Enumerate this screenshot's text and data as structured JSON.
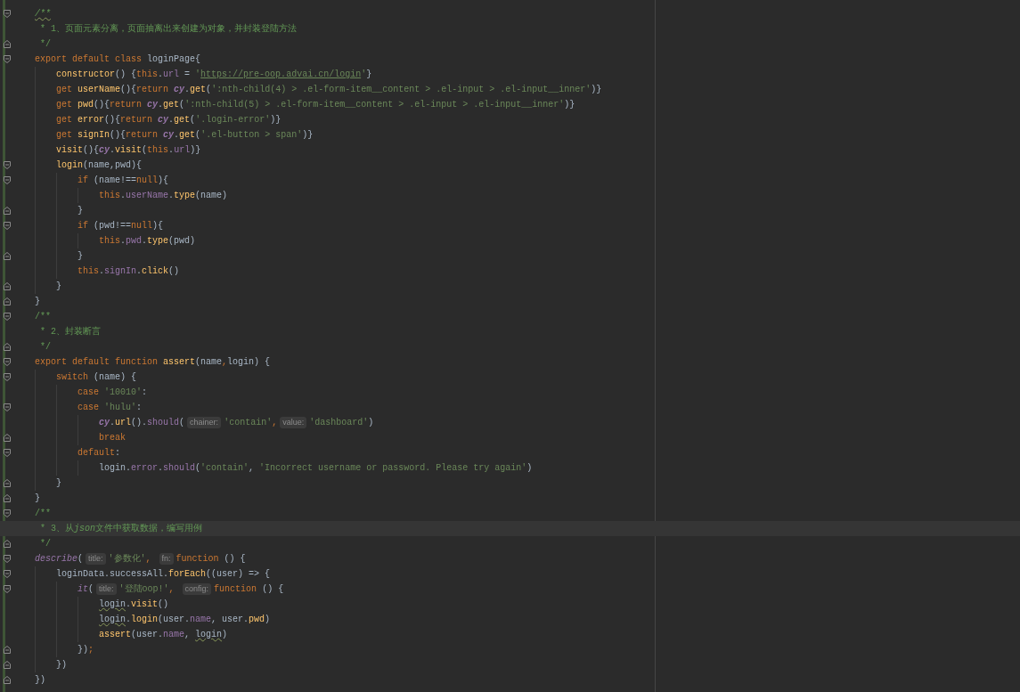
{
  "editor": {
    "lines": [
      {
        "fold_start": true,
        "fold_end": false,
        "tokens": [
          {
            "kind": "doc-squiggle",
            "text": "/**"
          }
        ]
      },
      {
        "fold_start": false,
        "fold_end": false,
        "tokens": [
          {
            "kind": "doc-body",
            "text": "* 1、页面元素分离，页面抽离出来创建为对象，并封装登陆方法"
          }
        ]
      },
      {
        "fold_start": false,
        "fold_end": true,
        "tokens": [
          {
            "kind": "doc-body",
            "text": "*/"
          }
        ]
      },
      {
        "fold_start": true,
        "fold_end": false,
        "tokens": [
          {
            "kind": "keyword",
            "text": "export default class "
          },
          {
            "kind": "plain",
            "text": "loginPage{"
          }
        ],
        "children": [
          {
            "fold_start": false,
            "fold_end": false,
            "tokens": [
              {
                "kind": "fn",
                "text": "constructor"
              },
              {
                "kind": "plain",
                "text": "() {"
              },
              {
                "kind": "keyword",
                "text": "this"
              },
              {
                "kind": "plain",
                "text": "."
              },
              {
                "kind": "field",
                "text": "url"
              },
              {
                "kind": "plain",
                "text": " = "
              },
              {
                "kind": "string",
                "text": "'"
              },
              {
                "kind": "url",
                "text": "https://pre-oop.advai.cn/login"
              },
              {
                "kind": "string",
                "text": "'"
              },
              {
                "kind": "plain",
                "text": "}"
              }
            ]
          },
          {
            "fold_start": false,
            "fold_end": false,
            "tokens": [
              {
                "kind": "keyword",
                "text": "get "
              },
              {
                "kind": "fn",
                "text": "userName"
              },
              {
                "kind": "plain",
                "text": "(){"
              },
              {
                "kind": "keyword",
                "text": "return "
              },
              {
                "kind": "cy",
                "text": "cy"
              },
              {
                "kind": "plain",
                "text": "."
              },
              {
                "kind": "fn",
                "text": "get"
              },
              {
                "kind": "plain",
                "text": "("
              },
              {
                "kind": "string",
                "text": "':nth-child(4) > .el-form-item__content > .el-input > .el-input__inner'"
              },
              {
                "kind": "plain",
                "text": ")}"
              }
            ]
          },
          {
            "fold_start": false,
            "fold_end": false,
            "tokens": [
              {
                "kind": "keyword",
                "text": "get "
              },
              {
                "kind": "fn",
                "text": "pwd"
              },
              {
                "kind": "plain",
                "text": "(){"
              },
              {
                "kind": "keyword",
                "text": "return "
              },
              {
                "kind": "cy",
                "text": "cy"
              },
              {
                "kind": "plain",
                "text": "."
              },
              {
                "kind": "fn",
                "text": "get"
              },
              {
                "kind": "plain",
                "text": "("
              },
              {
                "kind": "string",
                "text": "':nth-child(5) > .el-form-item__content > .el-input > .el-input__inner'"
              },
              {
                "kind": "plain",
                "text": ")}"
              }
            ]
          },
          {
            "fold_start": false,
            "fold_end": false,
            "tokens": [
              {
                "kind": "keyword",
                "text": "get "
              },
              {
                "kind": "fn",
                "text": "error"
              },
              {
                "kind": "plain",
                "text": "(){"
              },
              {
                "kind": "keyword",
                "text": "return "
              },
              {
                "kind": "cy",
                "text": "cy"
              },
              {
                "kind": "plain",
                "text": "."
              },
              {
                "kind": "fn",
                "text": "get"
              },
              {
                "kind": "plain",
                "text": "("
              },
              {
                "kind": "string",
                "text": "'.login-error'"
              },
              {
                "kind": "plain",
                "text": ")}"
              }
            ]
          },
          {
            "fold_start": false,
            "fold_end": false,
            "tokens": [
              {
                "kind": "keyword",
                "text": "get "
              },
              {
                "kind": "fn",
                "text": "signIn"
              },
              {
                "kind": "plain",
                "text": "(){"
              },
              {
                "kind": "keyword",
                "text": "return "
              },
              {
                "kind": "cy",
                "text": "cy"
              },
              {
                "kind": "plain",
                "text": "."
              },
              {
                "kind": "fn",
                "text": "get"
              },
              {
                "kind": "plain",
                "text": "("
              },
              {
                "kind": "string",
                "text": "'.el-button > span'"
              },
              {
                "kind": "plain",
                "text": ")}"
              }
            ]
          },
          {
            "fold_start": false,
            "fold_end": false,
            "tokens": [
              {
                "kind": "fn",
                "text": "visit"
              },
              {
                "kind": "plain",
                "text": "(){"
              },
              {
                "kind": "cy",
                "text": "cy"
              },
              {
                "kind": "plain",
                "text": "."
              },
              {
                "kind": "fn",
                "text": "visit"
              },
              {
                "kind": "plain",
                "text": "("
              },
              {
                "kind": "keyword",
                "text": "this"
              },
              {
                "kind": "plain",
                "text": "."
              },
              {
                "kind": "field",
                "text": "url"
              },
              {
                "kind": "plain",
                "text": ")}"
              }
            ]
          },
          {
            "fold_start": true,
            "fold_end": false,
            "tokens": [
              {
                "kind": "fn",
                "text": "login"
              },
              {
                "kind": "plain",
                "text": "(name,pwd){"
              }
            ],
            "children": [
              {
                "fold_start": true,
                "fold_end": false,
                "tokens": [
                  {
                    "kind": "keyword",
                    "text": "if "
                  },
                  {
                    "kind": "plain",
                    "text": "(name!=="
                  },
                  {
                    "kind": "keyword",
                    "text": "null"
                  },
                  {
                    "kind": "plain",
                    "text": "){"
                  }
                ],
                "children": [
                  {
                    "fold_start": false,
                    "fold_end": false,
                    "tokens": [
                      {
                        "kind": "keyword",
                        "text": "this"
                      },
                      {
                        "kind": "plain",
                        "text": "."
                      },
                      {
                        "kind": "field",
                        "text": "userName"
                      },
                      {
                        "kind": "plain",
                        "text": "."
                      },
                      {
                        "kind": "fn",
                        "text": "type"
                      },
                      {
                        "kind": "plain",
                        "text": "(name)"
                      }
                    ]
                  }
                ]
              },
              {
                "fold_start": false,
                "fold_end": true,
                "tokens": [
                  {
                    "kind": "plain",
                    "text": "}"
                  }
                ]
              },
              {
                "fold_start": true,
                "fold_end": false,
                "tokens": [
                  {
                    "kind": "keyword",
                    "text": "if "
                  },
                  {
                    "kind": "plain",
                    "text": "(pwd!=="
                  },
                  {
                    "kind": "keyword",
                    "text": "null"
                  },
                  {
                    "kind": "plain",
                    "text": "){"
                  }
                ],
                "children": [
                  {
                    "fold_start": false,
                    "fold_end": false,
                    "tokens": [
                      {
                        "kind": "keyword",
                        "text": "this"
                      },
                      {
                        "kind": "plain",
                        "text": "."
                      },
                      {
                        "kind": "field",
                        "text": "pwd"
                      },
                      {
                        "kind": "plain",
                        "text": "."
                      },
                      {
                        "kind": "fn",
                        "text": "type"
                      },
                      {
                        "kind": "plain",
                        "text": "(pwd)"
                      }
                    ]
                  }
                ]
              },
              {
                "fold_start": false,
                "fold_end": true,
                "tokens": [
                  {
                    "kind": "plain",
                    "text": "}"
                  }
                ]
              },
              {
                "fold_start": false,
                "fold_end": false,
                "tokens": [
                  {
                    "kind": "keyword",
                    "text": "this"
                  },
                  {
                    "kind": "plain",
                    "text": "."
                  },
                  {
                    "kind": "field",
                    "text": "signIn"
                  },
                  {
                    "kind": "plain",
                    "text": "."
                  },
                  {
                    "kind": "fn",
                    "text": "click"
                  },
                  {
                    "kind": "plain",
                    "text": "()"
                  }
                ]
              }
            ]
          },
          {
            "fold_start": false,
            "fold_end": true,
            "tokens": [
              {
                "kind": "plain",
                "text": "}"
              }
            ]
          }
        ]
      },
      {
        "fold_start": false,
        "fold_end": true,
        "tokens": [
          {
            "kind": "plain",
            "text": "}"
          }
        ]
      },
      {
        "fold_start": true,
        "fold_end": false,
        "tokens": [
          {
            "kind": "doc",
            "text": "/**"
          }
        ]
      },
      {
        "fold_start": false,
        "fold_end": false,
        "tokens": [
          {
            "kind": "doc-body",
            "text": "* 2、封装断言"
          }
        ]
      },
      {
        "fold_start": false,
        "fold_end": true,
        "tokens": [
          {
            "kind": "doc-body",
            "text": "*/"
          }
        ]
      },
      {
        "fold_start": true,
        "fold_end": false,
        "tokens": [
          {
            "kind": "keyword",
            "text": "export default function "
          },
          {
            "kind": "fn",
            "text": "assert"
          },
          {
            "kind": "plain",
            "text": "(name"
          },
          {
            "kind": "keyword",
            "text": ","
          },
          {
            "kind": "plain",
            "text": "login) {"
          }
        ],
        "children": [
          {
            "fold_start": true,
            "fold_end": false,
            "tokens": [
              {
                "kind": "keyword",
                "text": "switch "
              },
              {
                "kind": "plain",
                "text": "(name) {"
              }
            ],
            "children": [
              {
                "fold_start": false,
                "fold_end": false,
                "tokens": [
                  {
                    "kind": "keyword",
                    "text": "case "
                  },
                  {
                    "kind": "string",
                    "text": "'10010'"
                  },
                  {
                    "kind": "plain",
                    "text": ":"
                  }
                ]
              },
              {
                "fold_start": true,
                "fold_end": false,
                "tokens": [
                  {
                    "kind": "keyword",
                    "text": "case "
                  },
                  {
                    "kind": "string",
                    "text": "'hulu'"
                  },
                  {
                    "kind": "plain",
                    "text": ":"
                  }
                ],
                "children": [
                  {
                    "fold_start": false,
                    "fold_end": false,
                    "tokens": [
                      {
                        "kind": "cy",
                        "text": "cy"
                      },
                      {
                        "kind": "plain",
                        "text": "."
                      },
                      {
                        "kind": "fn",
                        "text": "url"
                      },
                      {
                        "kind": "plain",
                        "text": "()."
                      },
                      {
                        "kind": "field",
                        "text": "should"
                      },
                      {
                        "kind": "plain",
                        "text": "("
                      },
                      {
                        "kind": "hint",
                        "text": "chainer:"
                      },
                      {
                        "kind": "string",
                        "text": "'contain'"
                      },
                      {
                        "kind": "keyword",
                        "text": ","
                      },
                      {
                        "kind": "hint",
                        "text": "value:"
                      },
                      {
                        "kind": "string",
                        "text": "'dashboard'"
                      },
                      {
                        "kind": "plain",
                        "text": ")"
                      }
                    ]
                  },
                  {
                    "fold_start": false,
                    "fold_end": true,
                    "tokens": [
                      {
                        "kind": "keyword",
                        "text": "break"
                      }
                    ]
                  }
                ]
              },
              {
                "fold_start": true,
                "fold_end": false,
                "tokens": [
                  {
                    "kind": "keyword",
                    "text": "default"
                  },
                  {
                    "kind": "plain",
                    "text": ":"
                  }
                ],
                "children": [
                  {
                    "fold_start": false,
                    "fold_end": false,
                    "tokens": [
                      {
                        "kind": "plain",
                        "text": "login."
                      },
                      {
                        "kind": "field",
                        "text": "error"
                      },
                      {
                        "kind": "plain",
                        "text": "."
                      },
                      {
                        "kind": "field",
                        "text": "should"
                      },
                      {
                        "kind": "plain",
                        "text": "("
                      },
                      {
                        "kind": "string",
                        "text": "'contain'"
                      },
                      {
                        "kind": "plain",
                        "text": ", "
                      },
                      {
                        "kind": "string",
                        "text": "'Incorrect username or password. Please try again'"
                      },
                      {
                        "kind": "plain",
                        "text": ")"
                      }
                    ]
                  }
                ]
              }
            ]
          },
          {
            "fold_start": false,
            "fold_end": true,
            "tokens": [
              {
                "kind": "plain",
                "text": "}"
              }
            ]
          }
        ]
      },
      {
        "fold_start": false,
        "fold_end": true,
        "tokens": [
          {
            "kind": "plain",
            "text": "}"
          }
        ]
      },
      {
        "fold_start": true,
        "fold_end": false,
        "tokens": [
          {
            "kind": "doc",
            "text": "/**"
          }
        ]
      },
      {
        "fold_start": false,
        "fold_end": false,
        "current": true,
        "tokens": [
          {
            "kind": "doc-body",
            "text": "* 3、从"
          },
          {
            "kind": "doc-italic",
            "text": "json"
          },
          {
            "kind": "doc",
            "text": "文件中获取数据，编写用例"
          }
        ]
      },
      {
        "fold_start": false,
        "fold_end": true,
        "tokens": [
          {
            "kind": "doc-body",
            "text": "*/"
          }
        ]
      },
      {
        "fold_start": true,
        "fold_end": false,
        "tokens": [
          {
            "kind": "test",
            "text": "describe"
          },
          {
            "kind": "plain",
            "text": "("
          },
          {
            "kind": "hint",
            "text": "title:"
          },
          {
            "kind": "string",
            "text": "'参数化'"
          },
          {
            "kind": "keyword",
            "text": ", "
          },
          {
            "kind": "hint",
            "text": "fn:"
          },
          {
            "kind": "keyword",
            "text": "function"
          },
          {
            "kind": "plain",
            "text": " () {"
          }
        ],
        "children": [
          {
            "fold_start": true,
            "fold_end": false,
            "tokens": [
              {
                "kind": "plain",
                "text": "loginData.successAll."
              },
              {
                "kind": "fn",
                "text": "forEach"
              },
              {
                "kind": "plain",
                "text": "((user) => {"
              }
            ],
            "children": [
              {
                "fold_start": true,
                "fold_end": false,
                "tokens": [
                  {
                    "kind": "test",
                    "text": "it"
                  },
                  {
                    "kind": "plain",
                    "text": "("
                  },
                  {
                    "kind": "hint",
                    "text": "title:"
                  },
                  {
                    "kind": "string",
                    "text": "'登陆oop!'"
                  },
                  {
                    "kind": "keyword",
                    "text": ", "
                  },
                  {
                    "kind": "hint",
                    "text": "config:"
                  },
                  {
                    "kind": "keyword",
                    "text": "function"
                  },
                  {
                    "kind": "plain",
                    "text": " () {"
                  }
                ],
                "children": [
                  {
                    "fold_start": false,
                    "fold_end": false,
                    "tokens": [
                      {
                        "kind": "plain-squiggle",
                        "text": "login"
                      },
                      {
                        "kind": "plain",
                        "text": "."
                      },
                      {
                        "kind": "fn",
                        "text": "visit"
                      },
                      {
                        "kind": "plain",
                        "text": "()"
                      }
                    ]
                  },
                  {
                    "fold_start": false,
                    "fold_end": false,
                    "tokens": [
                      {
                        "kind": "plain-squiggle",
                        "text": "login"
                      },
                      {
                        "kind": "plain",
                        "text": "."
                      },
                      {
                        "kind": "fn",
                        "text": "login"
                      },
                      {
                        "kind": "plain",
                        "text": "(user."
                      },
                      {
                        "kind": "field",
                        "text": "name"
                      },
                      {
                        "kind": "plain",
                        "text": ", user."
                      },
                      {
                        "kind": "fn",
                        "text": "pwd"
                      },
                      {
                        "kind": "plain",
                        "text": ")"
                      }
                    ]
                  },
                  {
                    "fold_start": false,
                    "fold_end": false,
                    "tokens": [
                      {
                        "kind": "fn",
                        "text": "assert"
                      },
                      {
                        "kind": "plain",
                        "text": "(user."
                      },
                      {
                        "kind": "field",
                        "text": "name"
                      },
                      {
                        "kind": "plain",
                        "text": ", "
                      },
                      {
                        "kind": "plain-squiggle",
                        "text": "login"
                      },
                      {
                        "kind": "plain",
                        "text": ")"
                      }
                    ]
                  }
                ]
              },
              {
                "fold_start": false,
                "fold_end": true,
                "tokens": [
                  {
                    "kind": "plain",
                    "text": "})"
                  },
                  {
                    "kind": "keyword",
                    "text": ";"
                  }
                ]
              }
            ]
          },
          {
            "fold_start": false,
            "fold_end": true,
            "tokens": [
              {
                "kind": "plain",
                "text": "})"
              }
            ]
          }
        ]
      },
      {
        "fold_start": false,
        "fold_end": true,
        "tokens": [
          {
            "kind": "plain",
            "text": "})"
          }
        ]
      }
    ]
  }
}
